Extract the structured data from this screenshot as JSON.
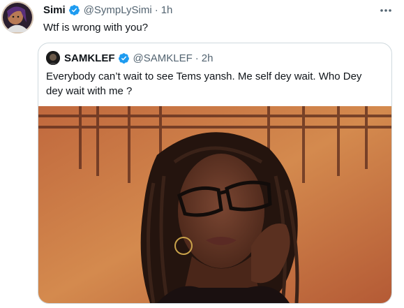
{
  "tweet": {
    "author_name": "Simi",
    "author_handle": "@SympLySimi",
    "separator": "·",
    "time": "1h",
    "text": "Wtf is wrong with you?"
  },
  "quoted": {
    "author_name": "SAMKLEF",
    "author_handle": "@SAMKLEF",
    "separator": "·",
    "time": "2h",
    "text": "Everybody can’t wait to see Tems yansh. Me self dey wait. Who Dey dey wait with me ?"
  },
  "icons": {
    "verified": "verified-badge-icon",
    "more": "more-dots-icon"
  },
  "colors": {
    "verified_blue": "#1d9bf0",
    "secondary_text": "#536471",
    "border": "#cfd9de"
  }
}
